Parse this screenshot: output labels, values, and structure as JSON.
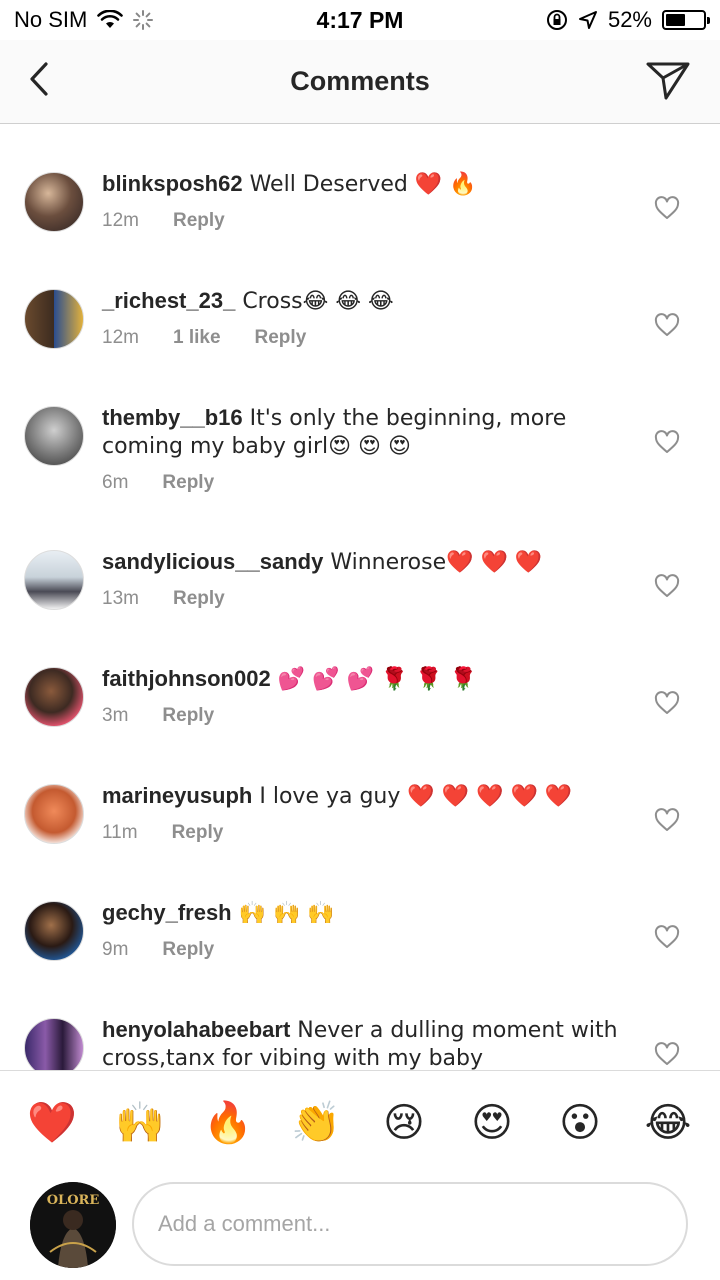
{
  "status_bar": {
    "carrier": "No SIM",
    "time": "4:17 PM",
    "battery_percent": "52%",
    "battery_level": 0.52,
    "icons": [
      "wifi-icon",
      "activity-spinner-icon",
      "orientation-lock-icon",
      "location-arrow-icon",
      "battery-icon"
    ]
  },
  "nav": {
    "title": "Comments",
    "back_icon": "chevron-left-icon",
    "send_icon": "paper-plane-icon"
  },
  "comments": [
    {
      "username": "blinksposh62",
      "text": " Well Deserved ❤️ 🔥",
      "time": "12m",
      "likes": "",
      "reply": "Reply"
    },
    {
      "username": "_richest_23_",
      "text": " Cross😂 😂 😂",
      "time": "12m",
      "likes": "1 like",
      "reply": "Reply"
    },
    {
      "username": "themby__b16",
      "text": " It's only the beginning, more coming my baby girl😍 😍 😍",
      "time": "6m",
      "likes": "",
      "reply": "Reply"
    },
    {
      "username": "sandylicious__sandy",
      "text": " Winnerose❤️ ❤️ ❤️",
      "time": "13m",
      "likes": "",
      "reply": "Reply"
    },
    {
      "username": "faithjohnson002",
      "text": " 💕 💕 💕 🌹 🌹 🌹",
      "time": "3m",
      "likes": "",
      "reply": "Reply"
    },
    {
      "username": "marineyusuph",
      "text": " I love ya guy ❤️ ❤️ ❤️ ❤️ ❤️",
      "time": "11m",
      "likes": "",
      "reply": "Reply"
    },
    {
      "username": "gechy_fresh",
      "text": " 🙌 🙌 🙌",
      "time": "9m",
      "likes": "",
      "reply": "Reply"
    },
    {
      "username": "henyolahabeebart",
      "text": " Never a dulling moment with cross,tanx for vibing with my baby",
      "time": "",
      "likes": "",
      "reply": ""
    }
  ],
  "quick_emojis": [
    "❤️",
    "🙌",
    "🔥",
    "👏",
    "😢",
    "😍",
    "😮",
    "😂"
  ],
  "input": {
    "placeholder": "Add a comment...",
    "my_avatar_text": "OLORE"
  },
  "colors": {
    "text": "#262626",
    "meta": "#8e8e8e",
    "divider": "#dbdbdb",
    "nav_bg": "#fafafa"
  }
}
